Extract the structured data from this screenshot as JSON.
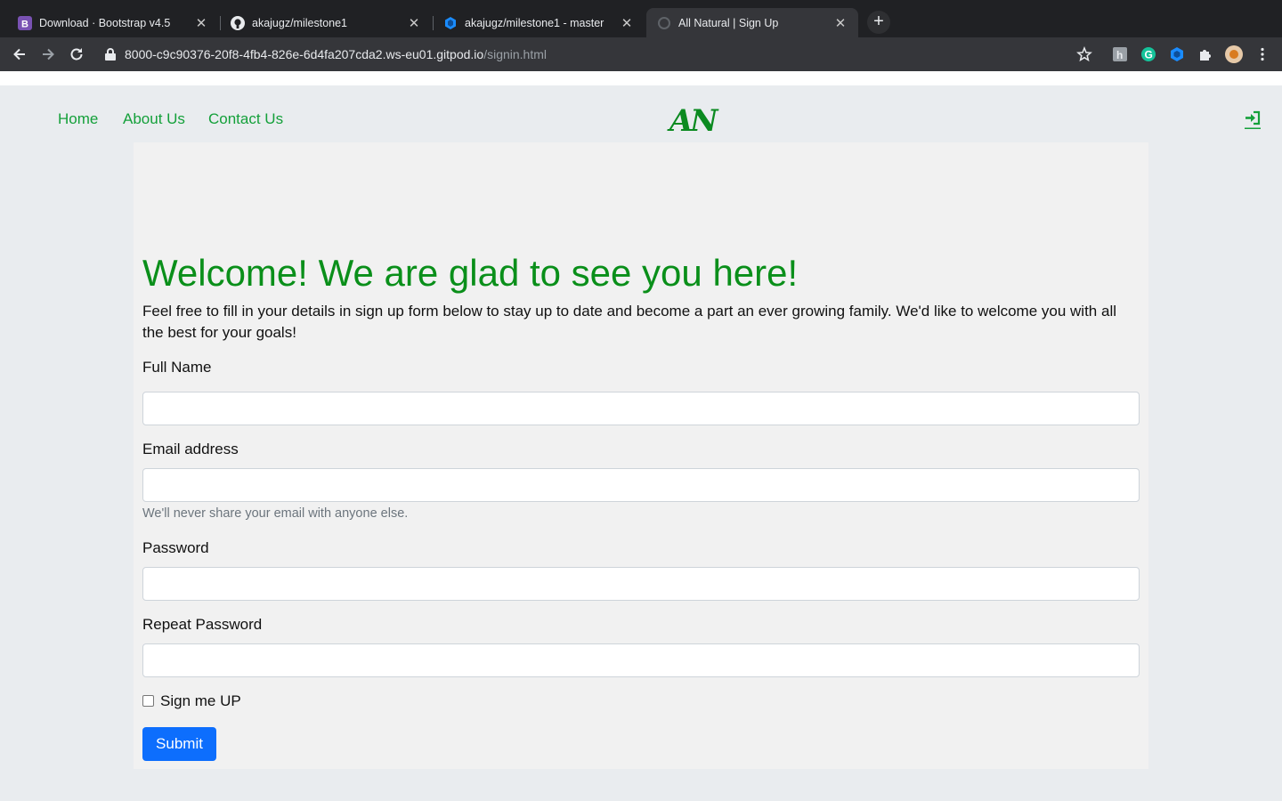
{
  "browser": {
    "tabs": [
      {
        "title": "Download · Bootstrap v4.5",
        "favicon": "bootstrap-icon",
        "active": false
      },
      {
        "title": "akajugz/milestone1",
        "favicon": "github-icon",
        "active": false
      },
      {
        "title": "akajugz/milestone1 - master",
        "favicon": "gitpod-icon",
        "active": false
      },
      {
        "title": "All Natural | Sign Up",
        "favicon": "page-icon",
        "active": true
      }
    ],
    "url_host": "8000-c9c90376-20f8-4fb4-826e-6d4fa207cda2.ws-eu01.gitpod.io",
    "url_path": "/signin.html"
  },
  "nav": {
    "links": [
      "Home",
      "About Us",
      "Contact Us"
    ],
    "brand": "AN",
    "login_icon": "sign-in-icon"
  },
  "main": {
    "headline": "Welcome! We are glad to see you here!",
    "lead": "Feel free to fill in your details in sign up form below to stay up to date and become a part an ever growing family. We'd like to welcome you with all the best for your goals!",
    "form": {
      "full_name_label": "Full Name",
      "email_label": "Email address",
      "email_help": "We'll never share your email with anyone else.",
      "password_label": "Password",
      "repeat_password_label": "Repeat Password",
      "checkbox_label": "Sign me UP",
      "submit_label": "Submit"
    }
  },
  "colors": {
    "brand_green": "#0b8a20",
    "link_green": "#14a03a",
    "primary": "#0d6efd"
  }
}
